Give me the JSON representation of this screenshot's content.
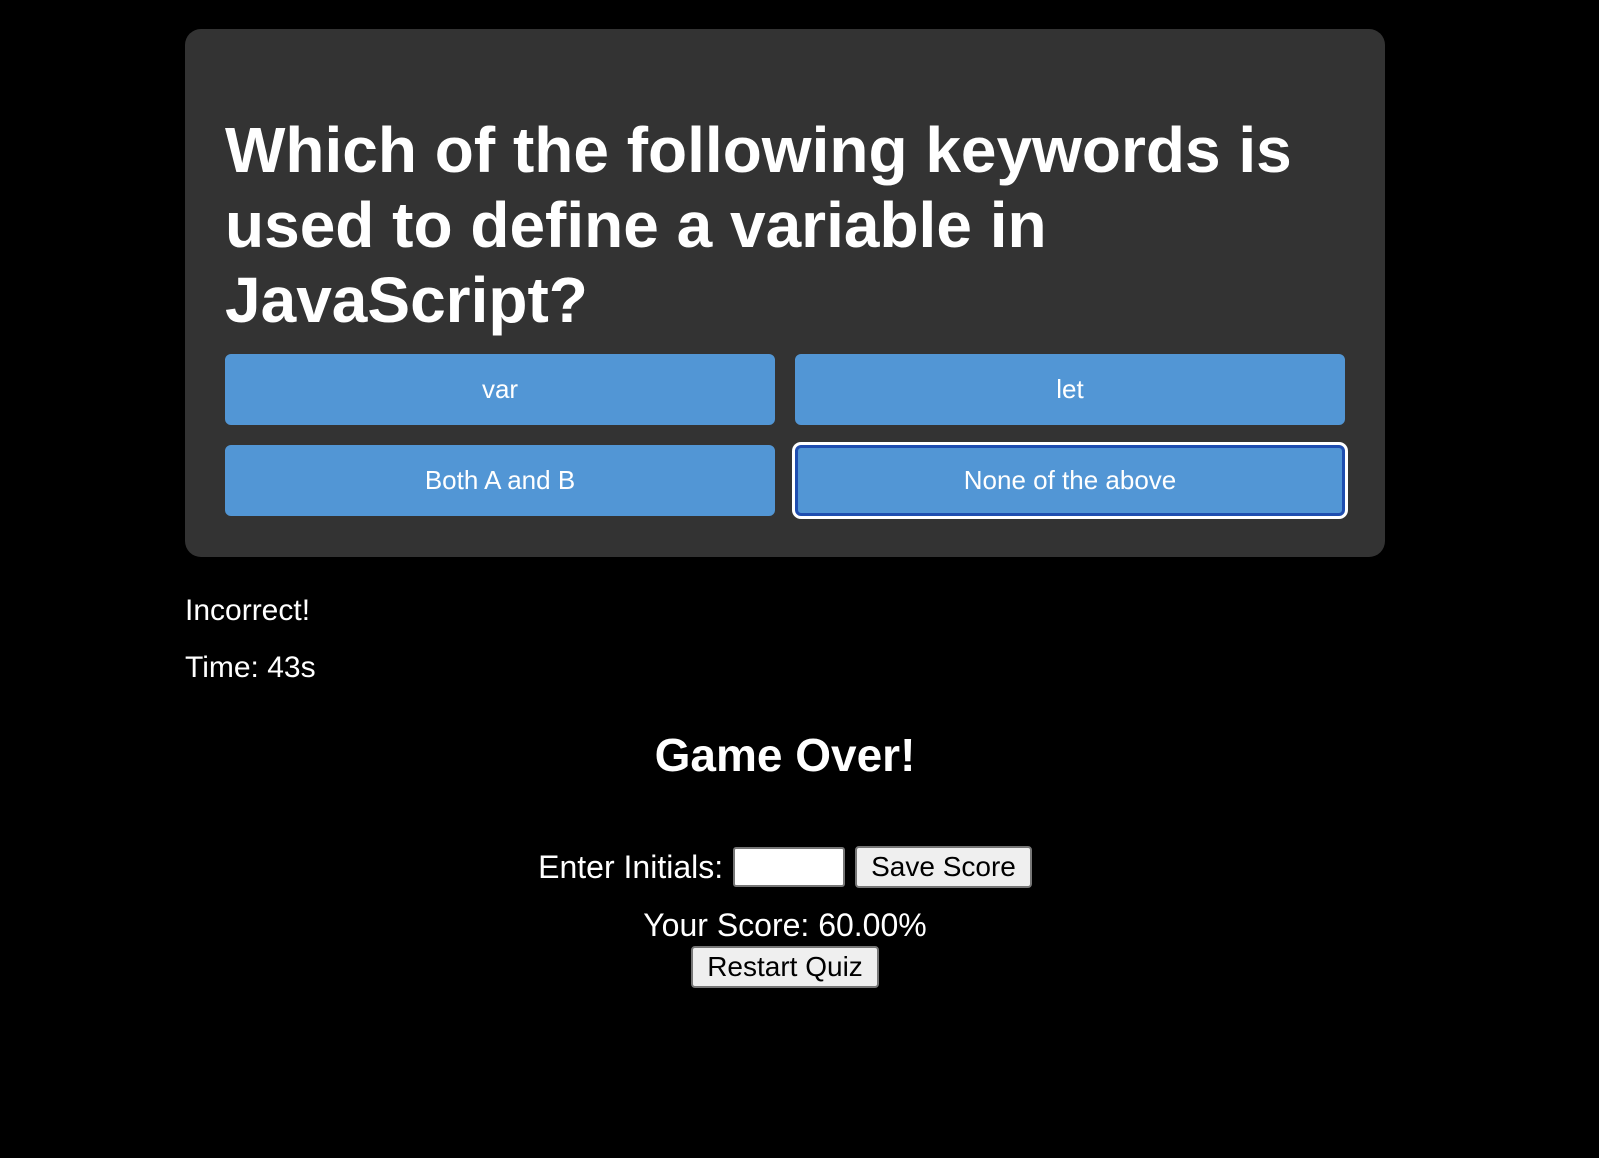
{
  "quiz": {
    "question": "Which of the following keywords is used to define a variable in JavaScript?",
    "answers": [
      {
        "label": "var"
      },
      {
        "label": "let"
      },
      {
        "label": "Both A and B"
      },
      {
        "label": "None of the above"
      }
    ],
    "focused_answer": "None of the above"
  },
  "status": {
    "feedback": "Incorrect!",
    "timer": "Time: 43s"
  },
  "end_screen": {
    "title": "Game Over!",
    "initials_label": "Enter Initials:",
    "initials_value": "",
    "save_label": "Save Score",
    "score_text": "Your Score: 60.00%",
    "restart_label": "Restart Quiz"
  },
  "colors": {
    "background": "#000000",
    "card": "#333333",
    "answer_button": "#5296d5",
    "focus_ring": "#1f4eb0"
  }
}
